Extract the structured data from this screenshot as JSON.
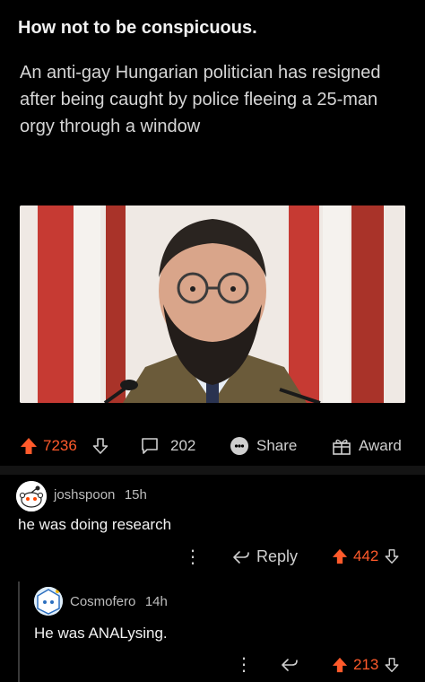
{
  "post": {
    "title": "How not to be conspicuous.",
    "headline": "An anti-gay Hungarian politician has resigned after being caught by police fleeing a 25-man orgy through a window",
    "upvotes": "7236",
    "comments": "202",
    "share_label": "Share",
    "award_label": "Award"
  },
  "comments": [
    {
      "author": "joshspoon",
      "age": "15h",
      "text": "he was doing research",
      "reply_label": "Reply",
      "score": "442"
    },
    {
      "author": "Cosmofero",
      "age": "14h",
      "text": "He was ANALysing.",
      "score": "213"
    }
  ],
  "colors": {
    "accent": "#ff5a2b",
    "background": "#000000",
    "text_muted": "#cfcfcf"
  }
}
